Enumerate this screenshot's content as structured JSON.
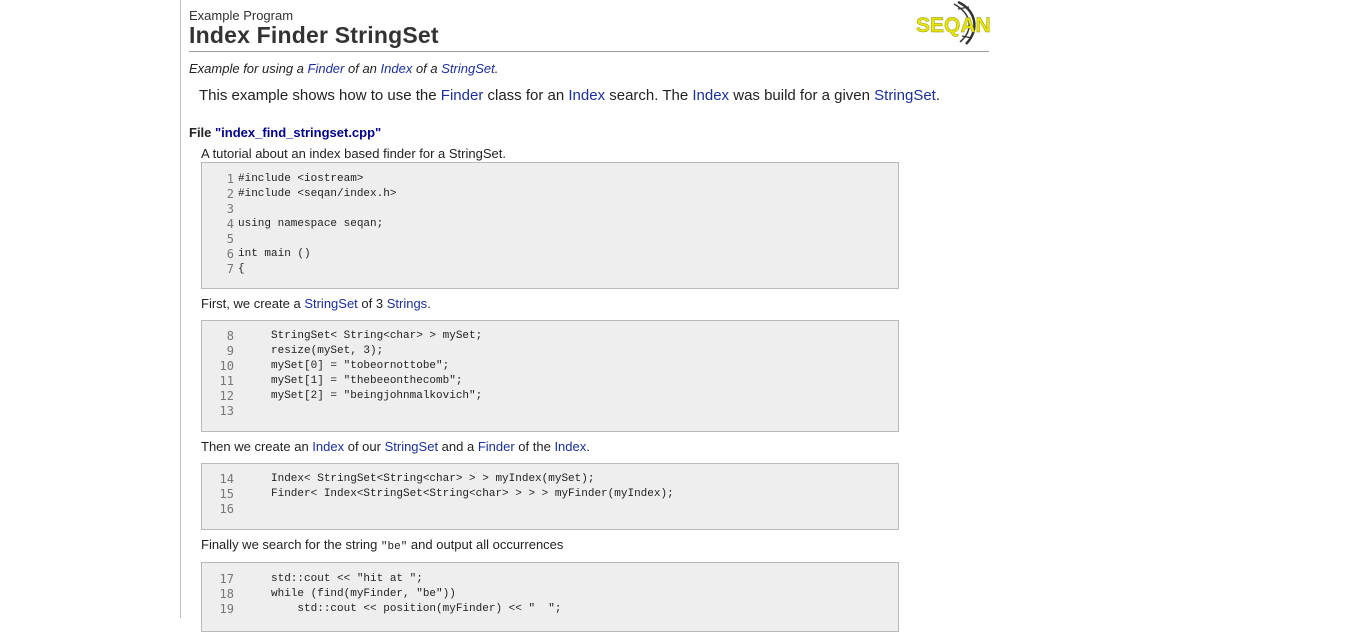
{
  "header": {
    "kicker": "Example Program",
    "title": "Index Finder StringSet",
    "logo_text": "SEQAN"
  },
  "summary": {
    "prefix": "Example for using a ",
    "link1": "Finder",
    "mid1": " of an ",
    "link2": "Index",
    "mid2": " of a ",
    "link3": "StringSet",
    "suffix": "."
  },
  "description": {
    "t1": "This example shows how to use the ",
    "l1": "Finder",
    "t2": " class for an ",
    "l2": "Index",
    "t3": " search. The ",
    "l3": "Index",
    "t4": " was build for a given ",
    "l4": "StringSet",
    "t5": "."
  },
  "file": {
    "label": "File ",
    "name": "\"index_find_stringset.cpp\""
  },
  "tutorial_intro": "A tutorial about an index based finder for a StringSet.",
  "step1": {
    "t1": "First, we create a ",
    "l1": "StringSet",
    "t2": " of 3 ",
    "l2": "Strings",
    "t3": "."
  },
  "step2": {
    "t1": "Then we create an ",
    "l1": "Index",
    "t2": " of our ",
    "l2": "StringSet",
    "t3": " and a ",
    "l3": "Finder",
    "t4": " of the ",
    "l4": "Index",
    "t5": "."
  },
  "step3": {
    "t1": "Finally we search for the string ",
    "code": "\"be\"",
    "t2": " and output all occurrences"
  },
  "code_blocks": [
    {
      "lines": [
        {
          "n": "1",
          "code": "#include <iostream>"
        },
        {
          "n": "2",
          "code": "#include <seqan/index.h>"
        },
        {
          "n": "3",
          "code": ""
        },
        {
          "n": "4",
          "code": "using namespace seqan;"
        },
        {
          "n": "5",
          "code": ""
        },
        {
          "n": "6",
          "code": "int main ()"
        },
        {
          "n": "7",
          "code": "{"
        }
      ]
    },
    {
      "lines": [
        {
          "n": "8",
          "code": "     StringSet< String<char> > mySet;"
        },
        {
          "n": "9",
          "code": "     resize(mySet, 3);"
        },
        {
          "n": "10",
          "code": "     mySet[0] = \"tobeornottobe\";"
        },
        {
          "n": "11",
          "code": "     mySet[1] = \"thebeeonthecomb\";"
        },
        {
          "n": "12",
          "code": "     mySet[2] = \"beingjohnmalkovich\";"
        },
        {
          "n": "13",
          "code": ""
        }
      ]
    },
    {
      "lines": [
        {
          "n": "14",
          "code": "     Index< StringSet<String<char> > > myIndex(mySet);"
        },
        {
          "n": "15",
          "code": "     Finder< Index<StringSet<String<char> > > > myFinder(myIndex);"
        },
        {
          "n": "16",
          "code": ""
        }
      ]
    },
    {
      "lines": [
        {
          "n": "17",
          "code": "     std::cout << \"hit at \";"
        },
        {
          "n": "18",
          "code": "     while (find(myFinder, \"be\"))"
        },
        {
          "n": "19",
          "code": "         std::cout << position(myFinder) << \"  \";"
        }
      ]
    }
  ],
  "colors": {
    "link": "#1a2f9c",
    "code_bg": "#eeeeee",
    "logo_yellow": "#e6e600"
  }
}
